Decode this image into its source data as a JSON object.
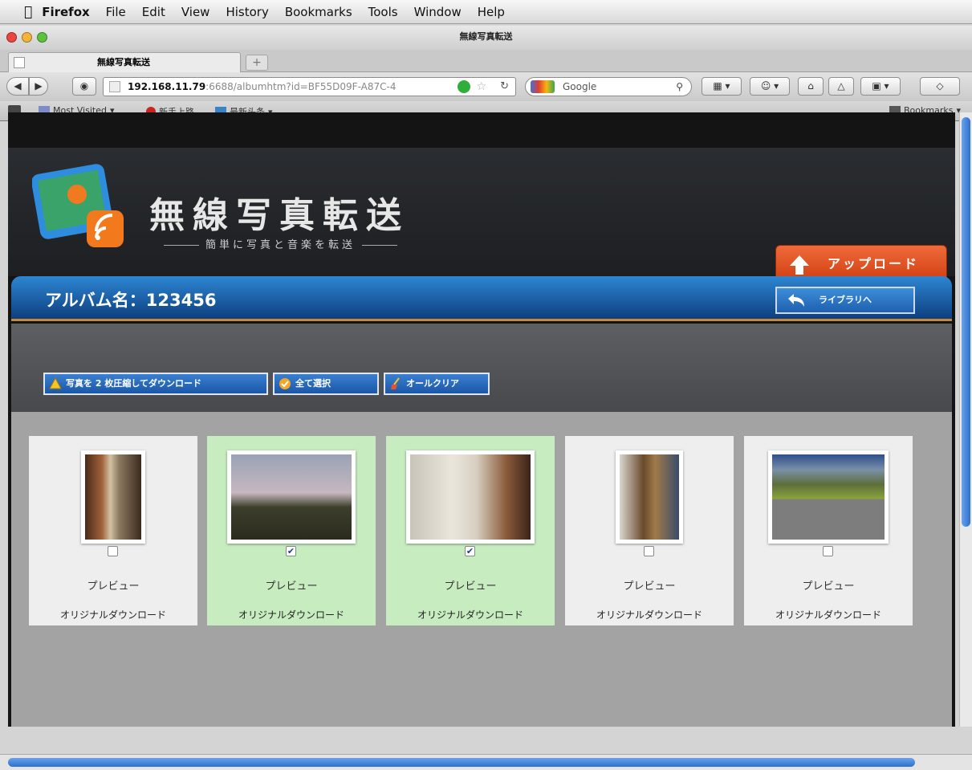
{
  "menubar": {
    "app": "Firefox",
    "items": [
      "File",
      "Edit",
      "View",
      "History",
      "Bookmarks",
      "Tools",
      "Window",
      "Help"
    ]
  },
  "window": {
    "title": "無線写真転送",
    "tab_title": "無線写真転送"
  },
  "navbar": {
    "url_host": "192.168.11.79",
    "url_rest": ":6688/albumhtm?id=BF55D09F-A87C-4",
    "search_placeholder": "Google"
  },
  "bookmarks_bar": {
    "items": [
      "Most Visited",
      "新手上路",
      "最新头条"
    ],
    "right_label": "Bookmarks"
  },
  "header": {
    "title": "無線写真転送",
    "subtitle": "簡単に写真と音楽を転送",
    "upload_label": "アップロード"
  },
  "album": {
    "name": "アルバム名：123456",
    "library_button": "ライブラリへ"
  },
  "toolbar": {
    "zip_download": "写真を 2 枚圧縮してダウンロード",
    "select_all": "全て選択",
    "clear_all": "オールクリア"
  },
  "photos": [
    {
      "selected": false,
      "preview": "プレビュー",
      "download": "オリジナルダウンロード"
    },
    {
      "selected": true,
      "preview": "プレビュー",
      "download": "オリジナルダウンロード"
    },
    {
      "selected": true,
      "preview": "プレビュー",
      "download": "オリジナルダウンロード"
    },
    {
      "selected": false,
      "preview": "プレビュー",
      "download": "オリジナルダウンロード"
    },
    {
      "selected": false,
      "preview": "プレビュー",
      "download": "オリジナルダウンロード"
    }
  ],
  "colors": {
    "accent_blue": "#1f5fb0",
    "upload_orange": "#e0521f",
    "selected_green": "#c7ecc0"
  }
}
